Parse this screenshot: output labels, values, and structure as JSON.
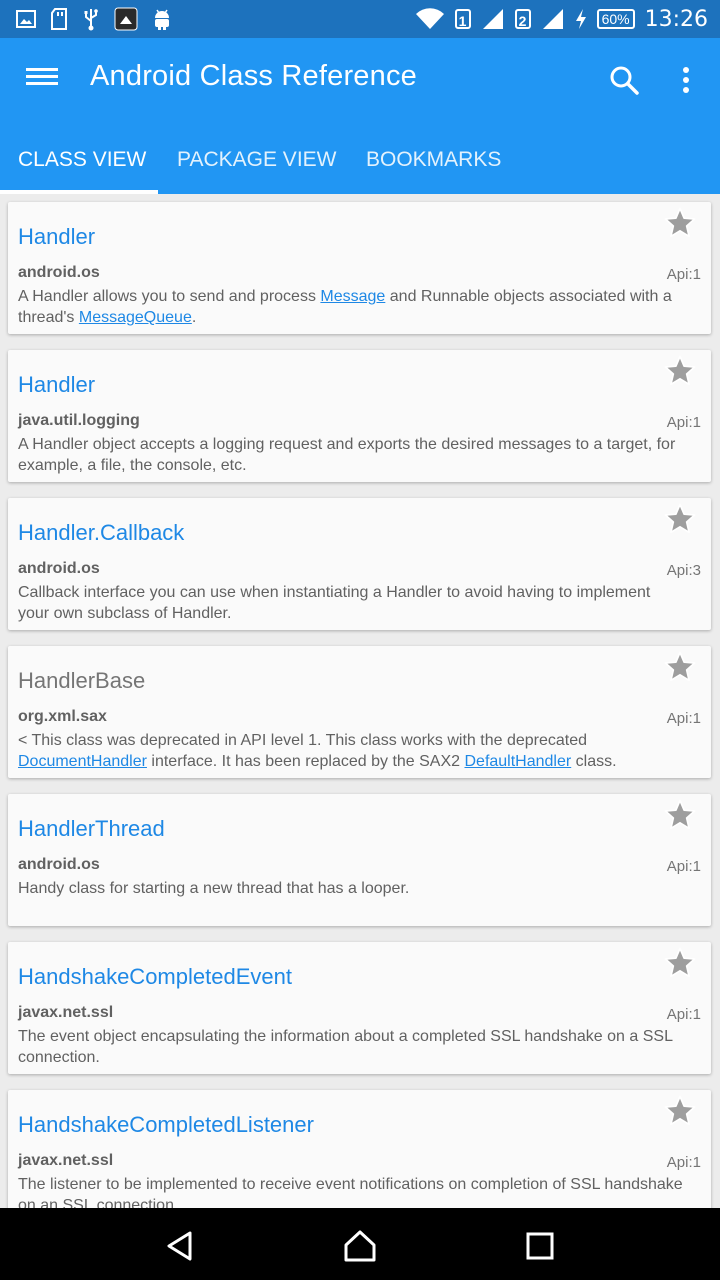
{
  "status_bar": {
    "sim1": "1",
    "sim2": "2",
    "battery": "60%",
    "time": "13:26",
    "icons": [
      "image-icon",
      "sd-card-icon",
      "usb-icon",
      "app-notification-icon",
      "android-icon",
      "wifi-icon",
      "signal-icon",
      "signal-icon",
      "charging-icon"
    ]
  },
  "app_bar": {
    "title": "Android Class Reference",
    "icons": [
      "menu-icon",
      "search-icon",
      "more-vert-icon"
    ]
  },
  "tabs": [
    {
      "label": "CLASS VIEW",
      "active": true
    },
    {
      "label": "PACKAGE VIEW",
      "active": false
    },
    {
      "label": "BOOKMARKS",
      "active": false
    }
  ],
  "classes": [
    {
      "name": "Handler",
      "package": "android.os",
      "api": "Api:1",
      "desc": [
        {
          "t": "A Handler allows you to send and process "
        },
        {
          "t": "Message",
          "link": true
        },
        {
          "t": " and Runnable objects associated with a thread's "
        },
        {
          "t": "MessageQueue",
          "link": true
        },
        {
          "t": "."
        }
      ]
    },
    {
      "name": "Handler",
      "package": "java.util.logging",
      "api": "Api:1",
      "desc": [
        {
          "t": "A Handler object accepts a logging request and exports the desired messages to a target, for example, a file, the console, etc."
        }
      ]
    },
    {
      "name": "Handler.Callback",
      "package": "android.os",
      "api": "Api:3",
      "desc": [
        {
          "t": "Callback interface you can use when instantiating a Handler to avoid having to implement your own subclass of Handler."
        }
      ]
    },
    {
      "name": "HandlerBase",
      "package": "org.xml.sax",
      "api": "Api:1",
      "deprecated": true,
      "desc": [
        {
          "t": "< This class was deprecated in API level 1. This class works with the deprecated "
        },
        {
          "t": "DocumentHandler",
          "link": true
        },
        {
          "t": " interface. It has been replaced by the SAX2 "
        },
        {
          "t": "DefaultHandler",
          "link": true
        },
        {
          "t": " class."
        }
      ]
    },
    {
      "name": "HandlerThread",
      "package": "android.os",
      "api": "Api:1",
      "desc": [
        {
          "t": "Handy class for starting a new thread that has a looper."
        }
      ]
    },
    {
      "name": "HandshakeCompletedEvent",
      "package": "javax.net.ssl",
      "api": "Api:1",
      "desc": [
        {
          "t": "The event object encapsulating the information about a completed SSL handshake on a SSL connection."
        }
      ]
    },
    {
      "name": "HandshakeCompletedListener",
      "package": "javax.net.ssl",
      "api": "Api:1",
      "desc": [
        {
          "t": "The listener to be implemented to receive event notifications on completion of SSL handshake on an SSL connection."
        }
      ]
    }
  ],
  "nav_bar": {
    "icons": [
      "back-icon",
      "home-icon",
      "recents-icon"
    ]
  },
  "colors": {
    "status_bar": "#1d72bd",
    "app_bar": "#2196f3",
    "link": "#1e88e5",
    "deprecated_title": "#757575"
  }
}
